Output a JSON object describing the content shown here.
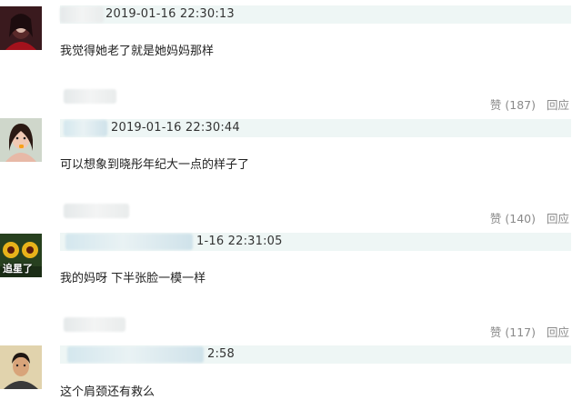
{
  "comments": [
    {
      "time": "2019-01-16 22:30:13",
      "text": "我觉得她老了就是她妈妈那样",
      "like_label": "赞 (187)",
      "reply_label": "回应"
    },
    {
      "time": "2019-01-16 22:30:44",
      "text": "可以想象到晓彤年纪大一点的样子了",
      "like_label": "赞 (140)",
      "reply_label": "回应"
    },
    {
      "time": "1-16 22:31:05",
      "text": "我的妈呀 下半张脸一模一样",
      "avatar_caption": "追星了",
      "like_label": "赞 (117)",
      "reply_label": "回应"
    },
    {
      "time": "2:58",
      "text": "这个肩颈还有救么"
    }
  ],
  "colors": {
    "meta_bar": "#eef6f5",
    "action_text": "#8a8a8a"
  }
}
